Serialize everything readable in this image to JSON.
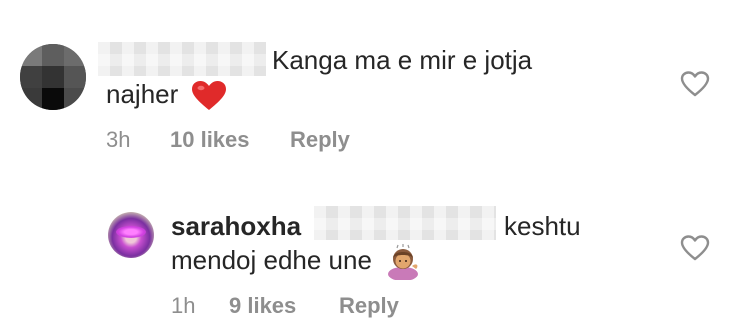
{
  "comments": [
    {
      "username": "",
      "text_line1": "Kanga ma e mir e jotja",
      "text_line2": "najher",
      "emoji": "red-heart",
      "time": "3h",
      "likes": "10 likes",
      "reply_label": "Reply",
      "like_icon": "heart-outline-icon"
    },
    {
      "username": "sarahoxha",
      "text_line1": "keshtu",
      "text_line2": "mendoj edhe une",
      "emoji": "person-tipping-hand",
      "time": "1h",
      "likes": "9 likes",
      "reply_label": "Reply",
      "like_icon": "heart-outline-icon"
    }
  ],
  "colors": {
    "text": "#262626",
    "meta": "#8e8e8e",
    "heart": "#e02a2a"
  }
}
